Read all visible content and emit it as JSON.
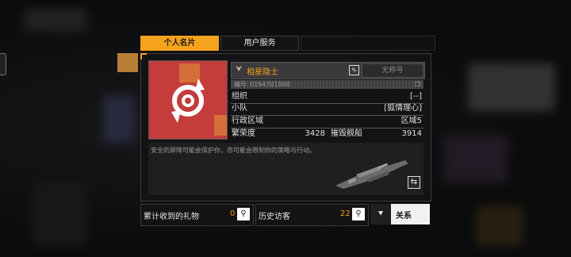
{
  "tabs": [
    {
      "label": "个人名片",
      "active": true
    },
    {
      "label": "用户服务",
      "active": false
    }
  ],
  "profile": {
    "name": "相星隐士",
    "nickname_placeholder": "无称号",
    "id_label": "编号",
    "id_value": "0194701868",
    "rows": [
      {
        "key": "组织",
        "value": "[--]"
      },
      {
        "key": "小队",
        "value": "[狐情理心]"
      },
      {
        "key": "行政区域",
        "value": "区域5"
      }
    ],
    "prosperity_label": "繁荣度",
    "prosperity_value": "3428",
    "destroyed_label": "摧毁舰船",
    "destroyed_value": "3914",
    "description": "安全的屏障可能会保护你，亦可能会限制你的策略与行动。"
  },
  "bottom": {
    "gifts_label": "累计收到的礼物",
    "gifts_count": "0",
    "visitors_label": "历史访客",
    "visitors_count": "22",
    "follow_label": "关系"
  },
  "colors": {
    "accent": "#f5a21c",
    "avatar_bg": "#c43c3c"
  },
  "icons": {
    "edit": "edit-icon",
    "search": "search-icon",
    "swap": "swap-icon",
    "follow": "relation-icon"
  }
}
